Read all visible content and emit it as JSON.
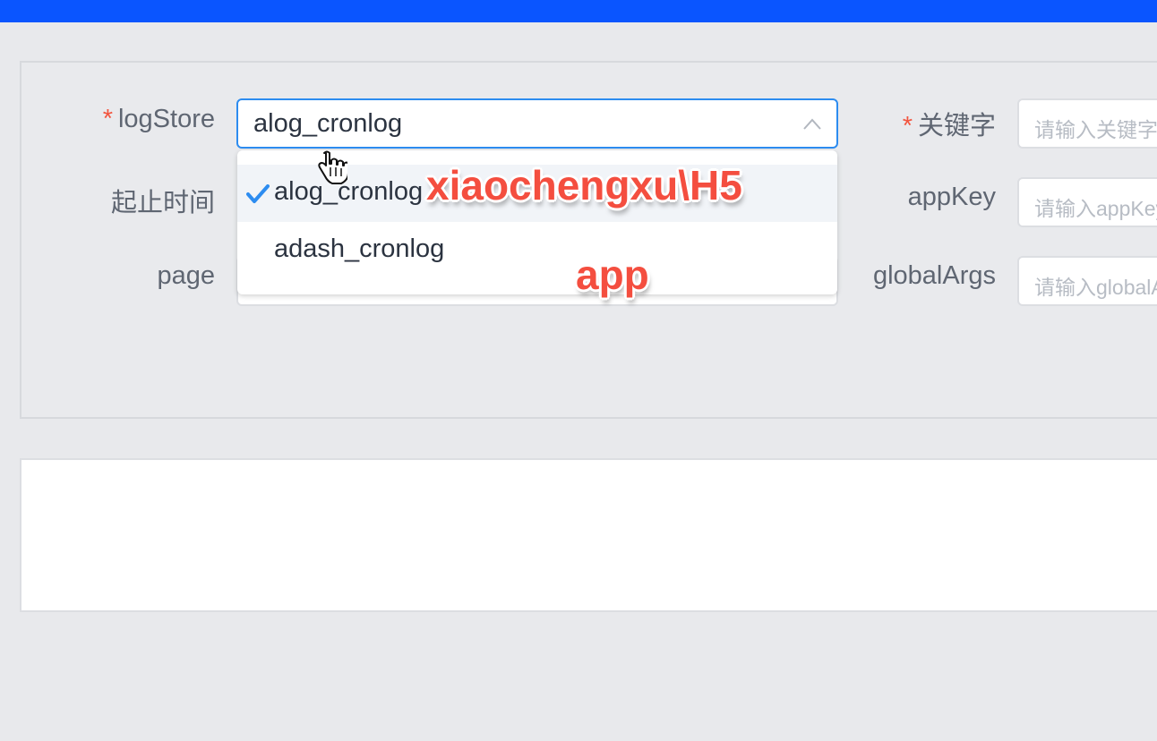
{
  "form": {
    "logstore_label": "logStore",
    "required_mark": "*",
    "time_label": "起止时间",
    "page_label": "page",
    "keyword_label": "关键字",
    "appkey_label": "appKey",
    "globalargs_label": "globalArgs"
  },
  "logstore_select": {
    "value": "alog_cronlog",
    "options": [
      {
        "label": "alog_cronlog",
        "selected": true
      },
      {
        "label": "adash_cronlog",
        "selected": false
      }
    ]
  },
  "inputs": {
    "keyword_placeholder": "请输入关键字",
    "appkey_placeholder": "请输入appKey",
    "globalargs_placeholder": "请输入globalArgs"
  },
  "annotations": {
    "first": "xiaochengxu\\H5",
    "second": "app"
  },
  "colors": {
    "topbar": "#0a55ff",
    "accent": "#2d8cf0",
    "required": "#f2553f",
    "annotation": "#f44e3f"
  }
}
